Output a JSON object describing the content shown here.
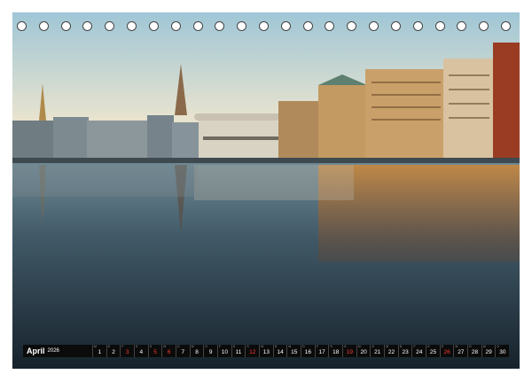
{
  "calendar": {
    "month_label": "April",
    "year_label": "2026",
    "days": [
      {
        "n": "1",
        "wd": "M",
        "red": false
      },
      {
        "n": "2",
        "wd": "D",
        "red": false
      },
      {
        "n": "3",
        "wd": "F",
        "red": true
      },
      {
        "n": "4",
        "wd": "S",
        "red": false
      },
      {
        "n": "5",
        "wd": "S",
        "red": true
      },
      {
        "n": "6",
        "wd": "M",
        "red": true
      },
      {
        "n": "7",
        "wd": "D",
        "red": false
      },
      {
        "n": "8",
        "wd": "M",
        "red": false
      },
      {
        "n": "9",
        "wd": "D",
        "red": false
      },
      {
        "n": "10",
        "wd": "F",
        "red": false
      },
      {
        "n": "11",
        "wd": "S",
        "red": false
      },
      {
        "n": "12",
        "wd": "S",
        "red": true
      },
      {
        "n": "13",
        "wd": "M",
        "red": false
      },
      {
        "n": "14",
        "wd": "D",
        "red": false
      },
      {
        "n": "15",
        "wd": "M",
        "red": false
      },
      {
        "n": "16",
        "wd": "D",
        "red": false
      },
      {
        "n": "17",
        "wd": "F",
        "red": false
      },
      {
        "n": "18",
        "wd": "S",
        "red": false
      },
      {
        "n": "19",
        "wd": "S",
        "red": true
      },
      {
        "n": "20",
        "wd": "M",
        "red": false
      },
      {
        "n": "21",
        "wd": "D",
        "red": false
      },
      {
        "n": "22",
        "wd": "M",
        "red": false
      },
      {
        "n": "23",
        "wd": "D",
        "red": false
      },
      {
        "n": "24",
        "wd": "F",
        "red": false
      },
      {
        "n": "25",
        "wd": "S",
        "red": false
      },
      {
        "n": "26",
        "wd": "S",
        "red": true
      },
      {
        "n": "27",
        "wd": "M",
        "red": false
      },
      {
        "n": "28",
        "wd": "D",
        "red": false
      },
      {
        "n": "29",
        "wd": "M",
        "red": false
      },
      {
        "n": "30",
        "wd": "D",
        "red": false
      }
    ]
  },
  "binding": {
    "ring_count": 23
  },
  "colors": {
    "sky_top": "#9fc6d6",
    "sky_horizon": "#f3e6c6",
    "water_dark": "#1c2a36",
    "weekend_red": "#ff3b30"
  }
}
